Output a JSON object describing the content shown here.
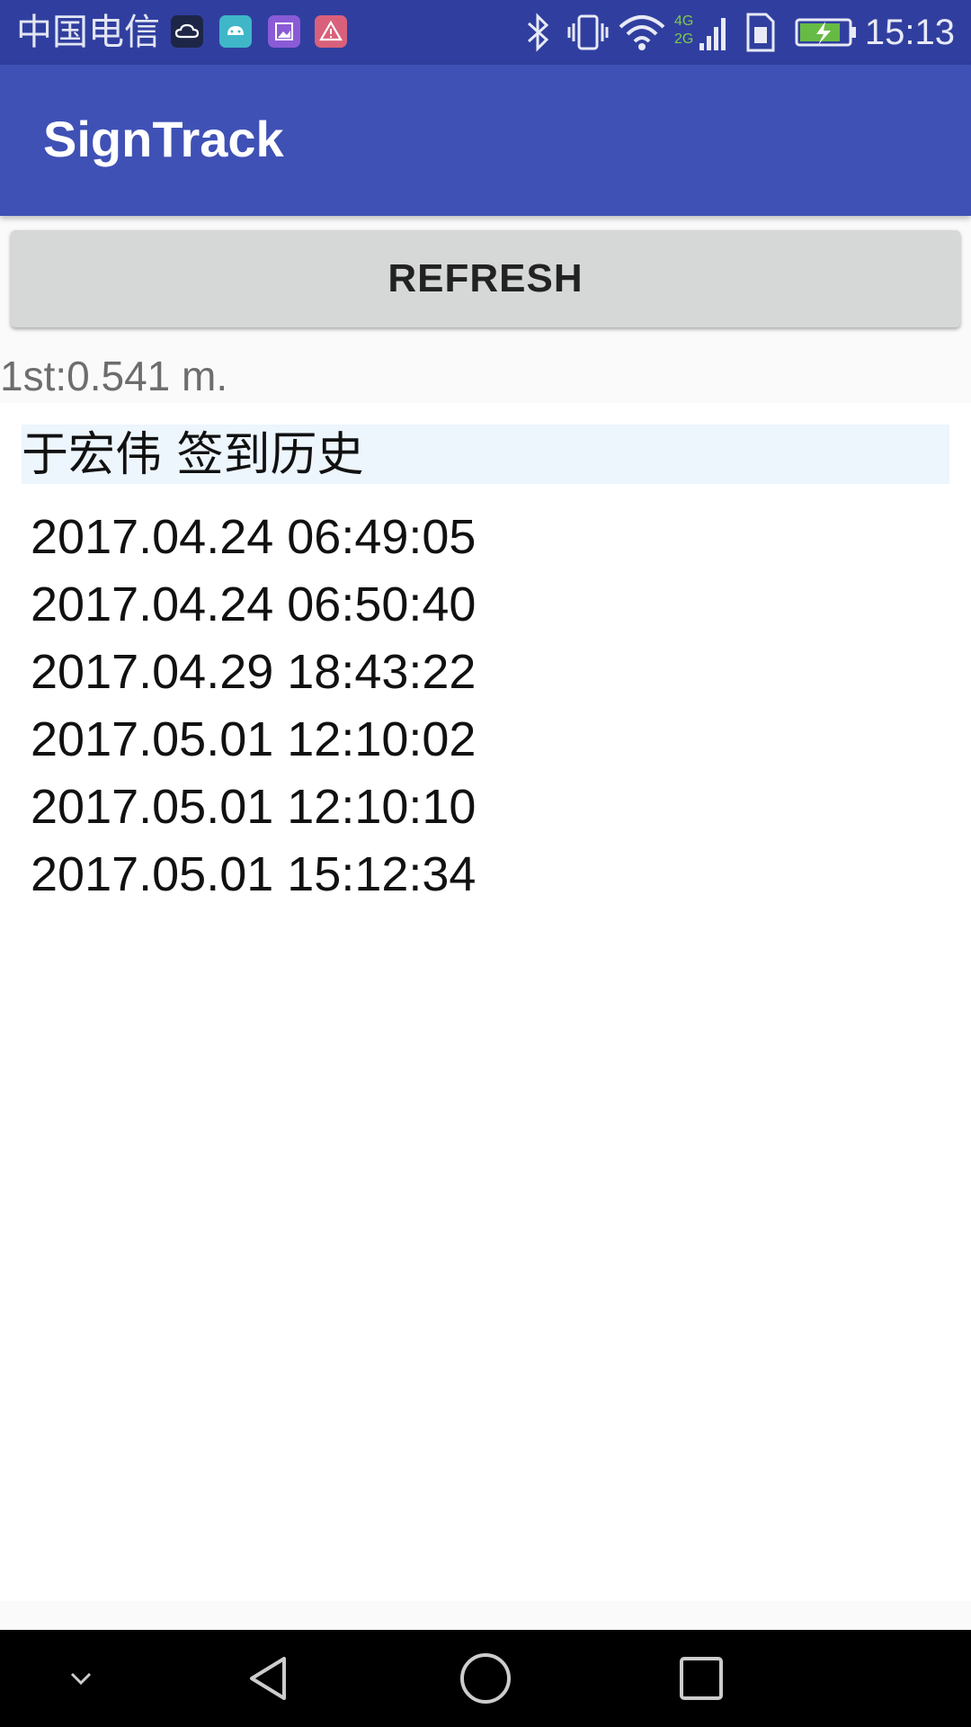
{
  "status_bar": {
    "carrier": "中国电信",
    "network_label_top": "4G",
    "network_label_bottom": "2G",
    "time": "15:13",
    "notification_icons": [
      "cloud-app-icon",
      "android-icon",
      "gallery-icon",
      "warning-icon"
    ],
    "status_icons": [
      "bluetooth-icon",
      "vibrate-icon",
      "wifi-icon",
      "signal-icon",
      "sim-icon",
      "battery-charging-icon"
    ]
  },
  "app_bar": {
    "title": "SignTrack"
  },
  "main": {
    "refresh_label": "REFRESH",
    "distance_text": "1st:0.541 m.",
    "history_title": "于宏伟 签到历史",
    "history": [
      "2017.04.24 06:49:05",
      "2017.04.24 06:50:40",
      "2017.04.29 18:43:22",
      "2017.05.01 12:10:02",
      "2017.05.01 12:10:10",
      "2017.05.01 15:12:34"
    ]
  },
  "nav_bar": {
    "buttons": [
      "collapse-icon",
      "back-icon",
      "home-icon",
      "recents-icon"
    ]
  },
  "colors": {
    "status_bar": "#303f9f",
    "app_bar": "#3f51b5",
    "button": "#d6d7d7",
    "history_header_bg": "#edf5fd"
  }
}
